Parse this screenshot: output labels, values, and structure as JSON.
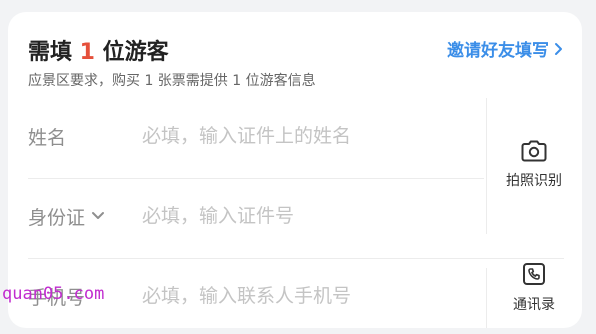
{
  "header": {
    "title_prefix": "需填 ",
    "count": "1",
    "title_suffix": " 位游客",
    "invite_label": "邀请好友填写",
    "subtitle": "应景区要求，购买 1 张票需提供 1 位游客信息"
  },
  "fields": {
    "name": {
      "label": "姓名",
      "placeholder": "必填，输入证件上的姓名",
      "value": ""
    },
    "id": {
      "label": "身份证",
      "placeholder": "必填，输入证件号",
      "value": ""
    },
    "phone": {
      "label": "手机号",
      "placeholder": "必填，输入联系人手机号",
      "value": ""
    }
  },
  "side": {
    "scan_label": "拍照识别",
    "scan_icon": "camera-icon",
    "contacts_label": "通讯录",
    "contacts_icon": "phone-book-icon"
  },
  "watermark": "quan05.com",
  "colors": {
    "accent": "#3b8ee8",
    "count": "#e5503b",
    "watermark": "#c12ccf"
  }
}
